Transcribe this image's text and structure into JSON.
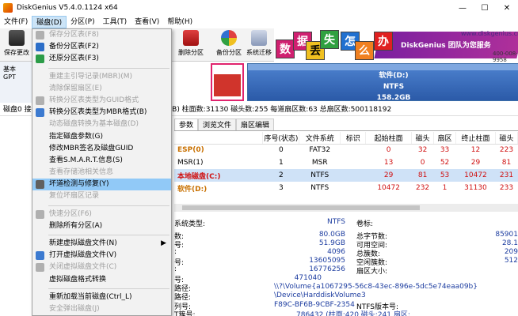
{
  "window": {
    "title": "DiskGenius V5.4.0.1124 x64"
  },
  "menubar": [
    "文件(F)",
    "磁盘(D)",
    "分区(P)",
    "工具(T)",
    "查看(V)",
    "帮助(H)"
  ],
  "toolbar": {
    "save_label": "保存更改",
    "delete_partition": "删除分区",
    "backup_partition": "备份分区",
    "system_migrate": "系统迁移"
  },
  "banner": {
    "chars": [
      "数",
      "据",
      "丢",
      "失",
      "怎",
      "么",
      "办"
    ],
    "slogan": "DiskGenius 团队为您服务",
    "url": "www.diskgenius.cn",
    "phone": "400-008-9958"
  },
  "left_info": {
    "line1": "基本",
    "line2": "GPT"
  },
  "diskmap": {
    "d_label": "软件(D:)",
    "d_fs": "NTFS",
    "d_size": "158.2GB"
  },
  "disk_row": "磁盘0 接口 ... 16579632 容量:238.5GB(244198MB) 柱面数:31130 磁头数:255 每道扇区数:63 总扇区数:500118192",
  "tabs": [
    "参数",
    "浏览文件",
    "扇区编辑"
  ],
  "partition_table": {
    "headers": [
      "",
      "序号(状态)",
      "文件系统",
      "标识",
      "起始柱面",
      "磁头",
      "扇区",
      "终止柱面",
      "磁头"
    ],
    "rows": [
      {
        "name": "ESP(0)",
        "index": "0",
        "fs": "FAT32",
        "flag": "",
        "start_cyl": "0",
        "head": "32",
        "sector": "33",
        "end_cyl": "12",
        "end_head": "223",
        "style": "orange"
      },
      {
        "name": "MSR(1)",
        "index": "1",
        "fs": "MSR",
        "flag": "",
        "start_cyl": "13",
        "head": "0",
        "sector": "52",
        "end_cyl": "29",
        "end_head": "81",
        "style": "plain"
      },
      {
        "name": "本地磁盘(C:)",
        "index": "2",
        "fs": "NTFS",
        "flag": "",
        "start_cyl": "29",
        "head": "81",
        "sector": "53",
        "end_cyl": "10472",
        "end_head": "231",
        "style": "red"
      },
      {
        "name": "软件(D:)",
        "index": "3",
        "fs": "NTFS",
        "flag": "",
        "start_cyl": "10472",
        "head": "232",
        "sector": "1",
        "end_cyl": "31130",
        "end_head": "233",
        "style": "orange"
      }
    ]
  },
  "details": {
    "fs_type_label": "系统类型:",
    "fs_type_value": "NTFS",
    "volume_label": "卷标:",
    "values_left": [
      "80.0GB",
      "51.9GB",
      "4096",
      "13605095",
      "16776256",
      "471040"
    ],
    "labels_right": [
      "总字节数:",
      "可用空间:",
      "总簇数:",
      "空闲簇数:",
      "扇区大小:"
    ],
    "values_right": [
      "85901",
      "28.1",
      "209",
      "512",
      ""
    ],
    "label_left_tail": [
      "数:",
      "号:",
      ":",
      "号:",
      ":",
      "号:"
    ],
    "path_label": "路径:",
    "path_value": "\\\\?\\Volume{a1067295-56c8-43ec-896e-5dc5e74eaa09b}",
    "device_label": "路径:",
    "device_value": "\\Device\\HarddiskVolume3",
    "serial_label": "列号:",
    "serial_value": "F89C-BF6B-9CBF-2354",
    "ntfs_ver_label": "NTFS版本号:",
    "mft_label": "T簇号:",
    "mft_value": "786432 (柱面:420 磁头:241 扇区:"
  },
  "dropdown": [
    {
      "label": "保存分区表(F8)",
      "disabled": true,
      "icon": "save-table-icon",
      "color": "#b0b0b0"
    },
    {
      "label": "备份分区表(F2)",
      "disabled": false,
      "icon": "backup-table-icon",
      "color": "#2c6ec8"
    },
    {
      "label": "还原分区表(F3)",
      "disabled": false,
      "icon": "restore-table-icon",
      "color": "#2c9c48"
    },
    {
      "sep": true
    },
    {
      "label": "重建主引导记录(MBR)(M)",
      "disabled": true,
      "icon": "",
      "color": ""
    },
    {
      "label": "清除保留扇区(E)",
      "disabled": true,
      "icon": "",
      "color": ""
    },
    {
      "label": "转换分区表类型为GUID格式",
      "disabled": true,
      "icon": "gpt-icon",
      "color": "#b0b0b0"
    },
    {
      "label": "转换分区表类型为MBR格式(B)",
      "disabled": false,
      "icon": "mbr-icon",
      "color": "#3c7ad0"
    },
    {
      "label": "动态磁盘转换为基本磁盘(D)",
      "disabled": true,
      "icon": "",
      "color": ""
    },
    {
      "label": "指定磁盘参数(G)",
      "disabled": false,
      "icon": "",
      "color": ""
    },
    {
      "label": "修改MBR签名及磁盘GUID",
      "disabled": false,
      "icon": "",
      "color": ""
    },
    {
      "label": "查看S.M.A.R.T.信息(S)",
      "disabled": false,
      "icon": "",
      "color": ""
    },
    {
      "label": "查看存储池相关信息",
      "disabled": true,
      "icon": "",
      "color": ""
    },
    {
      "label": "坏道检测与修复(Y)",
      "disabled": false,
      "icon": "repair-icon",
      "color": "#606060",
      "hl": true
    },
    {
      "label": "复位坏扇区记录",
      "disabled": true,
      "icon": "",
      "color": ""
    },
    {
      "sep": true
    },
    {
      "label": "快速分区(F6)",
      "disabled": true,
      "icon": "quick-partition-icon",
      "color": "#b0b0b0"
    },
    {
      "label": "删除所有分区(A)",
      "disabled": false,
      "icon": "",
      "color": ""
    },
    {
      "sep": true
    },
    {
      "label": "新建虚拟磁盘文件(N)",
      "disabled": false,
      "icon": "",
      "color": "",
      "arrow": true
    },
    {
      "label": "打开虚拟磁盘文件(V)",
      "disabled": false,
      "icon": "open-vdisk-icon",
      "color": "#3c7ad0"
    },
    {
      "label": "关闭虚拟磁盘文件(C)",
      "disabled": true,
      "icon": "close-vdisk-icon",
      "color": "#b0b0b0"
    },
    {
      "label": "虚拟磁盘格式转换",
      "disabled": false,
      "icon": "",
      "color": ""
    },
    {
      "sep": true
    },
    {
      "label": "重新加载当前磁盘(Ctrl_L)",
      "disabled": false,
      "icon": "",
      "color": ""
    },
    {
      "label": "安全弹出磁盘(J)",
      "disabled": true,
      "icon": "",
      "color": ""
    }
  ]
}
